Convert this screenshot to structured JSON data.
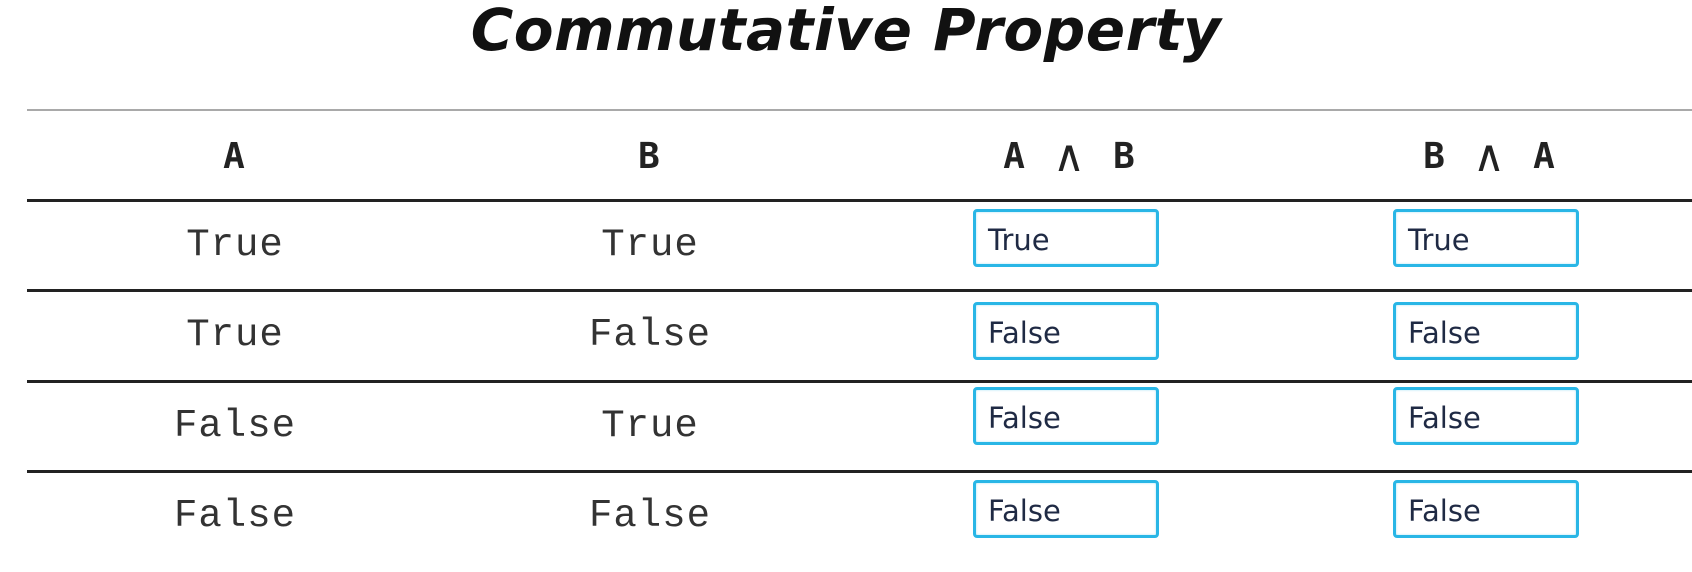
{
  "title": "Commutative Property",
  "table": {
    "headers": {
      "a": "A",
      "b": "B",
      "a_and_b": {
        "left": "A",
        "op": "∧",
        "right": "B"
      },
      "b_and_a": {
        "left": "B",
        "op": "∧",
        "right": "A"
      }
    },
    "rows": [
      {
        "a": "True",
        "b": "True",
        "a_and_b": "True",
        "b_and_a": "True"
      },
      {
        "a": "True",
        "b": "False",
        "a_and_b": "False",
        "b_and_a": "False"
      },
      {
        "a": "False",
        "b": "True",
        "a_and_b": "False",
        "b_and_a": "False"
      },
      {
        "a": "False",
        "b": "False",
        "a_and_b": "False",
        "b_and_a": "False"
      }
    ]
  },
  "colors": {
    "input_border": "#29b6e6",
    "rule": "#222222",
    "answer_text": "#1f2a44"
  }
}
